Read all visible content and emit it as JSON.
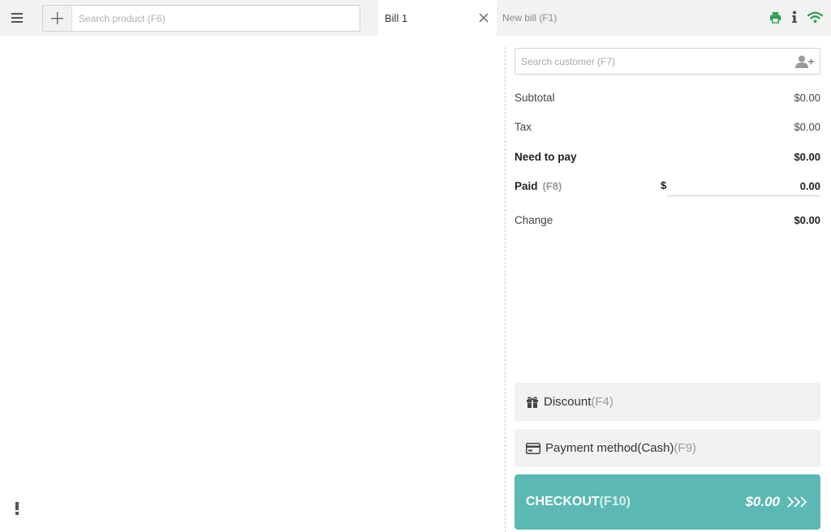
{
  "header": {
    "search": {
      "placeholder": "Search product (F6)",
      "value": ""
    },
    "tabs": [
      {
        "label": "Bill 1",
        "active": true
      },
      {
        "label": "New bill (F1)",
        "active": false
      }
    ],
    "icons": [
      "menu-icon",
      "plus-icon",
      "close-icon",
      "printer-icon",
      "info-icon",
      "wifi-icon"
    ],
    "accent_color": "#2e9e58"
  },
  "customer": {
    "placeholder": "Search customer (F7)",
    "value": ""
  },
  "summary": {
    "subtotal": {
      "label": "Subtotal",
      "value": "$0.00"
    },
    "tax": {
      "label": "Tax",
      "value": "$0.00"
    },
    "need_to_pay": {
      "label": "Need to pay",
      "value": "$0.00"
    },
    "paid": {
      "label": "Paid",
      "key": "(F8)",
      "currency": "$",
      "value": "0.00"
    },
    "change": {
      "label": "Change",
      "value": "$0.00"
    }
  },
  "actions": {
    "discount": {
      "label": "Discount",
      "key": "(F4)"
    },
    "payment": {
      "label": "Payment method(Cash)",
      "key": "(F9)"
    }
  },
  "checkout": {
    "label": "CHECKOUT",
    "key": "(F10)",
    "amount": "$0.00",
    "color": "#5cb8b2"
  },
  "footer": {
    "alert_glyph": "!"
  }
}
